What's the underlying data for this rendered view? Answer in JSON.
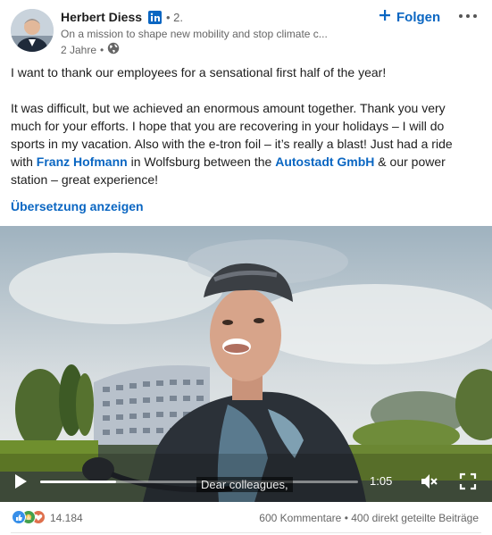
{
  "post": {
    "author": {
      "name": "Herbert Diess",
      "connection": "• 2.",
      "headline": "On a mission to shape new mobility and stop climate c...",
      "age": "2 Jahre",
      "bullet": "•"
    },
    "follow_label": "Folgen",
    "text": {
      "para1": "I want to thank our employees for a sensational first half of the year!",
      "para2_start": "It was difficult, but we achieved an enormous amount together. Thank you very much for your efforts. I hope that you are recovering in your holidays – I will do sports in my vacation. Also with the e-tron foil – it’s really a blast! Just had a ride with ",
      "mention1": "Franz Hofmann",
      "para2_mid": " in Wolfsburg between the ",
      "mention2": "Autostadt GmbH",
      "para2_end": " & our power station – great experience!"
    },
    "translate_label": "Übersetzung anzeigen"
  },
  "video": {
    "time": "1:05",
    "caption": "Dear colleagues,",
    "progress": 0.24
  },
  "footer": {
    "reaction_count": "14.184",
    "comments": "600 Kommentare",
    "separator": "•",
    "shares": "400 direkt geteilte Beiträge"
  },
  "icons": {
    "linkedin": "linkedin-icon",
    "globe": "globe-icon",
    "plus": "plus-icon",
    "more": "more-dots-icon",
    "play": "play-icon",
    "mute": "muted-speaker-icon",
    "fullscreen": "fullscreen-icon",
    "like": "like-icon",
    "celebrate": "celebrate-icon",
    "love": "love-icon"
  },
  "colors": {
    "accent": "#0a66c2",
    "text": "#1d1d1d",
    "muted": "#666666"
  }
}
